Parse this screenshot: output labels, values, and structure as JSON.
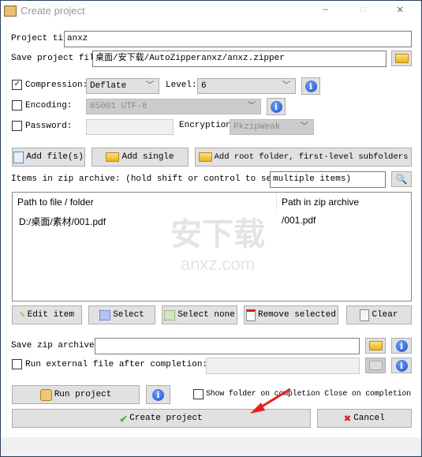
{
  "window": {
    "title": "Create project",
    "minimize": "—",
    "maximize": "☐",
    "close": "✕"
  },
  "form": {
    "project_title_label": "Project tit",
    "project_title_value": "anxz",
    "save_project_label": "Save project file to:",
    "save_project_value": "桌面/安下载/AutoZipperanxz/anxz.zipper",
    "compression_label": "Compression:",
    "compression_checked": true,
    "compression_value": "Deflate",
    "level_label": "Level:",
    "level_value": "6",
    "encoding_label": "Encoding:",
    "encoding_checked": false,
    "encoding_value": "65001 UTF-8",
    "password_label": "Password:",
    "password_checked": false,
    "password_value": "",
    "encryption_label": "Encryption:",
    "encryption_value": "PkzipWeak"
  },
  "add_buttons": {
    "add_files": "Add file(s)",
    "add_single": "Add single",
    "add_root": "Add root folder, first-level subfolders"
  },
  "items": {
    "label": "Items in zip archive: (hold shift or control to select",
    "filter_value": "multiple items)"
  },
  "list": {
    "columns": [
      "Path to file / folder",
      "Path in zip archive"
    ],
    "rows": [
      [
        "D:/桌面/素材/001.pdf",
        "/001.pdf"
      ]
    ],
    "watermark": "安下载",
    "watermark_sub": "anxz.com"
  },
  "item_buttons": {
    "edit": "Edit item",
    "select": "Select",
    "select_none": "Select none",
    "remove": "Remove selected",
    "clear": "Clear"
  },
  "save_zip": {
    "label": "Save zip archive to:",
    "value": ""
  },
  "run_external": {
    "label": "Run external file after completion:",
    "checked": false,
    "value": ""
  },
  "bottom": {
    "run_project": "Run project",
    "show_folder": "Show folder on completion Close on completion",
    "show_folder_checked": false,
    "create": "Create project",
    "cancel": "Cancel"
  },
  "colors": {
    "accent_info": "#1a4fc4",
    "arrow": "#e8201a"
  }
}
